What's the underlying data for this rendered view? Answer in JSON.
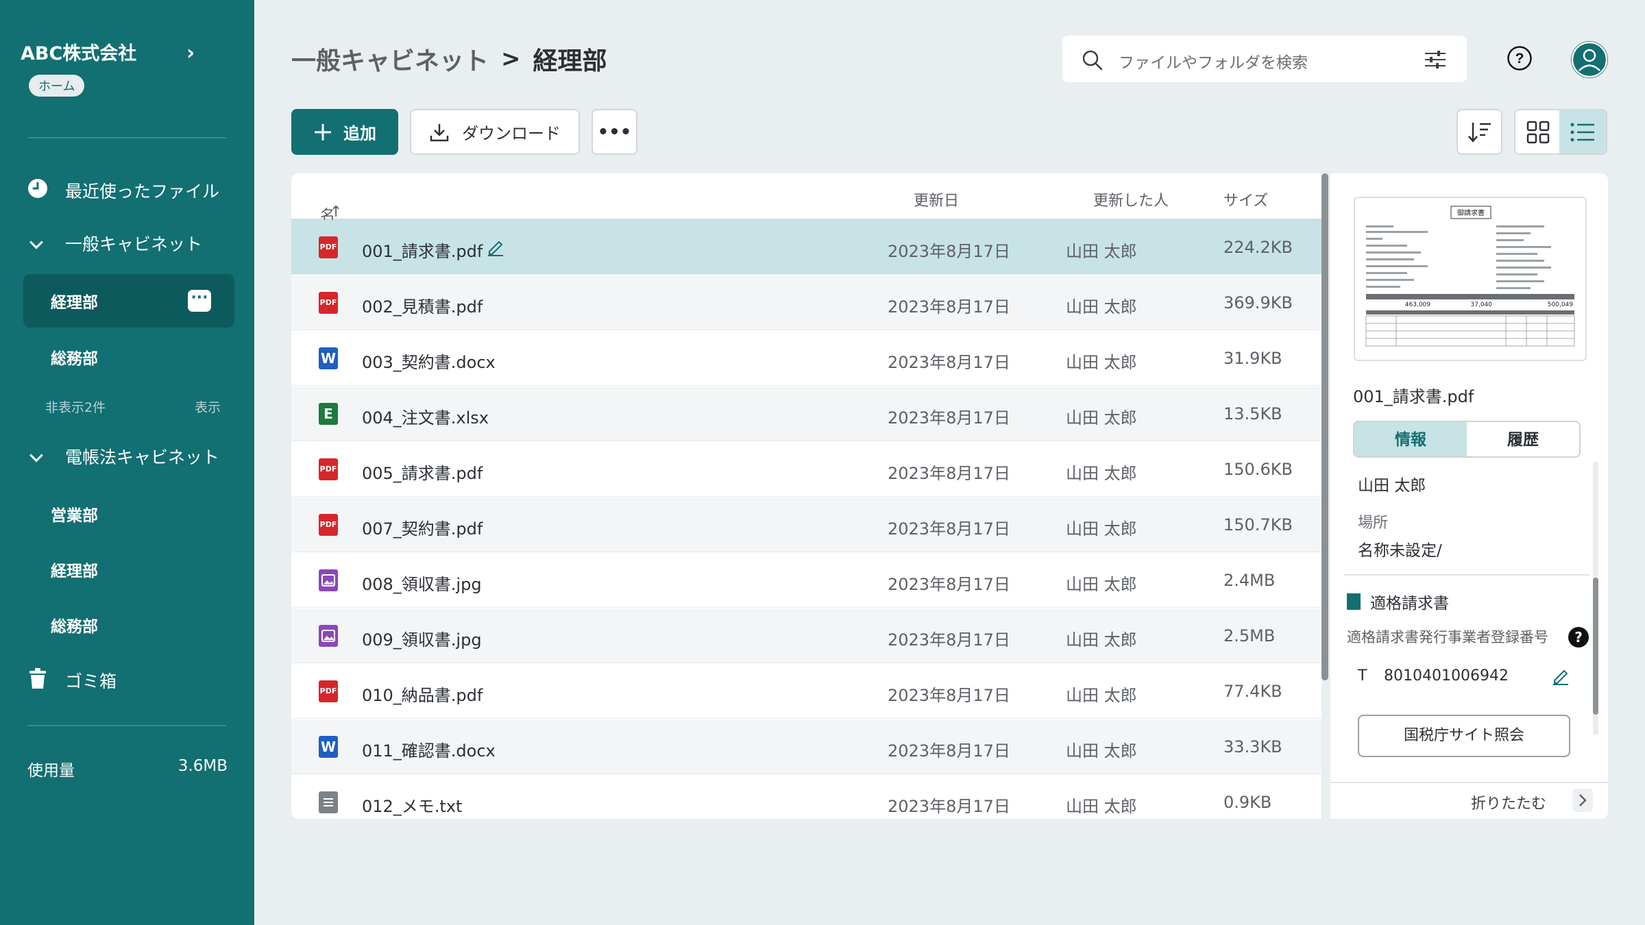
{
  "sidebar": {
    "company": "ABC株式会社",
    "home_badge": "ホーム",
    "recent": "最近使ったファイル",
    "cabinet1": "一般キャビネット",
    "cabinet1_items": [
      "経理部",
      "総務部"
    ],
    "hidden_count": "非表示2件",
    "show_label": "表示",
    "cabinet2": "電帳法キャビネット",
    "cabinet2_items": [
      "営業部",
      "経理部",
      "総務部"
    ],
    "trash": "ゴミ箱",
    "usage_label": "使用量",
    "usage_value": "3.6MB",
    "accent": "#126f72"
  },
  "header": {
    "crumb_parent": "一般キャビネット",
    "crumb_sep": ">",
    "crumb_current": "経理部",
    "search_placeholder": "ファイルやフォルダを検索"
  },
  "toolbar": {
    "add": "追加",
    "download": "ダウンロード",
    "more": "•••"
  },
  "table": {
    "headers": {
      "name": "名前",
      "updated": "更新日",
      "updated_by": "更新した人",
      "size": "サイズ"
    },
    "rows": [
      {
        "name": "001_請求書.pdf",
        "date": "2023年8月17日",
        "user": "山田 太郎",
        "size": "224.2KB",
        "type": "pdf"
      },
      {
        "name": "002_見積書.pdf",
        "date": "2023年8月17日",
        "user": "山田 太郎",
        "size": "369.9KB",
        "type": "pdf"
      },
      {
        "name": "003_契約書.docx",
        "date": "2023年8月17日",
        "user": "山田 太郎",
        "size": "31.9KB",
        "type": "word"
      },
      {
        "name": "004_注文書.xlsx",
        "date": "2023年8月17日",
        "user": "山田 太郎",
        "size": "13.5KB",
        "type": "excel"
      },
      {
        "name": "005_請求書.pdf",
        "date": "2023年8月17日",
        "user": "山田 太郎",
        "size": "150.6KB",
        "type": "pdf"
      },
      {
        "name": "007_契約書.pdf",
        "date": "2023年8月17日",
        "user": "山田 太郎",
        "size": "150.7KB",
        "type": "pdf"
      },
      {
        "name": "008_領収書.jpg",
        "date": "2023年8月17日",
        "user": "山田 太郎",
        "size": "2.4MB",
        "type": "image"
      },
      {
        "name": "009_領収書.jpg",
        "date": "2023年8月17日",
        "user": "山田 太郎",
        "size": "2.5MB",
        "type": "image"
      },
      {
        "name": "010_納品書.pdf",
        "date": "2023年8月17日",
        "user": "山田 太郎",
        "size": "77.4KB",
        "type": "pdf"
      },
      {
        "name": "011_確認書.docx",
        "date": "2023年8月17日",
        "user": "山田 太郎",
        "size": "33.3KB",
        "type": "word"
      },
      {
        "name": "012_メモ.txt",
        "date": "2023年8月17日",
        "user": "山田 太郎",
        "size": "0.9KB",
        "type": "text"
      }
    ]
  },
  "detail": {
    "file_name": "001_請求書.pdf",
    "tab_info": "情報",
    "tab_history": "履歴",
    "user": "山田 太郎",
    "location_label": "場所",
    "location": "名称未設定/",
    "qualified_invoice": "適格請求書",
    "reg_label": "適格請求書発行事業者登録番号",
    "reg_prefix": "T",
    "reg_number": "8010401006942",
    "nta_button": "国税庁サイト照会",
    "collapse": "折りたたむ",
    "thumb_title": "御請求書",
    "thumb_amounts": [
      "463,009",
      "37,040",
      "500,049"
    ]
  }
}
